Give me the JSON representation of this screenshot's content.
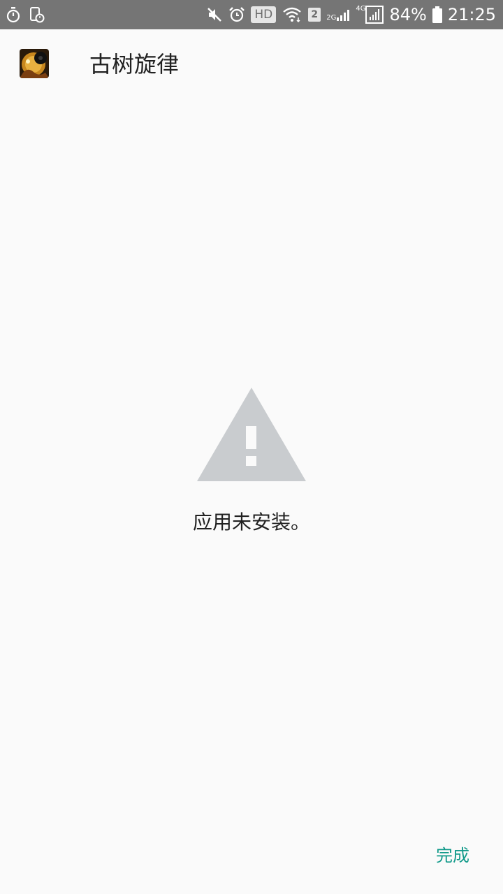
{
  "status_bar": {
    "hd_label": "HD",
    "sim_slot": "2",
    "net_2g": "2G",
    "net_4g": "4G",
    "battery_percent": "84%",
    "time": "21:25",
    "icons": [
      "stopwatch-icon",
      "screen-time-icon",
      "mute-icon",
      "alarm-icon",
      "wifi-icon",
      "signal-icon",
      "battery-icon"
    ]
  },
  "header": {
    "app_name": "古树旋律"
  },
  "main": {
    "message": "应用未安装。",
    "icon": "warning-icon",
    "icon_color": "#c9cccf"
  },
  "footer": {
    "done_label": "完成",
    "done_color": "#119a8a"
  }
}
